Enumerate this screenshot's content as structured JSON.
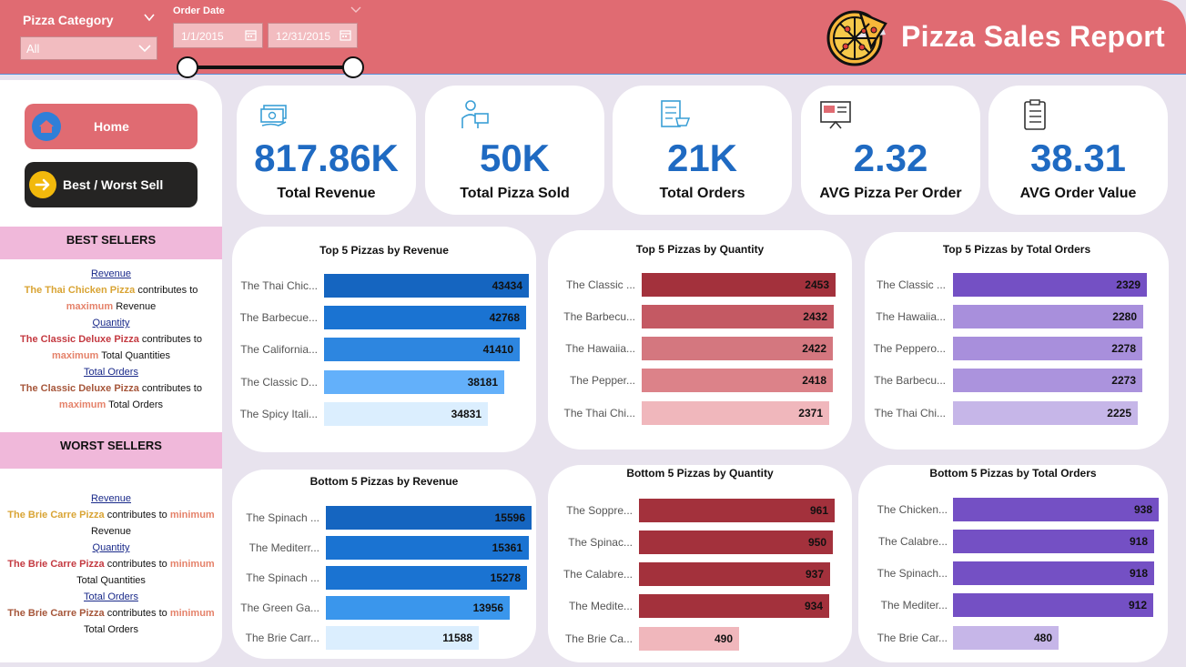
{
  "header": {
    "title": "Pizza Sales Report",
    "category_label": "Pizza Category",
    "category_value": "All",
    "date_label": "Order Date",
    "date_start": "1/1/2015",
    "date_end": "12/31/2015"
  },
  "nav": {
    "home": "Home",
    "best_worst": "Best / Worst Sell"
  },
  "best_sellers": {
    "heading": "BEST SELLERS",
    "revenue_link": "Revenue",
    "revenue_pizza": "The Thai Chicken Pizza",
    "contributes_to": "contributes to",
    "maximum": "maximum",
    "revenue_word": "Revenue",
    "quantity_link": "Quantity",
    "quantity_pizza": "The Classic Deluxe Pizza",
    "total_quantities": "Total Quantities",
    "orders_link": "Total Orders",
    "orders_pizza": "The Classic Deluxe Pizza",
    "total_orders": "Total Orders"
  },
  "worst_sellers": {
    "heading": "WORST SELLERS",
    "revenue_link": "Revenue",
    "revenue_pizza": "The Brie Carre Pizza",
    "contributes_to": "contributes to",
    "minimum": "minimum",
    "revenue_word": "Revenue",
    "quantity_link": "Quantity",
    "quantity_pizza": "The Brie Carre Pizza",
    "total_quantities": "Total Quantities",
    "orders_link": "Total Orders",
    "orders_pizza": "The Brie Carre Pizza",
    "total_orders": "Total Orders"
  },
  "kpis": [
    {
      "value": "817.86K",
      "caption": "Total Revenue",
      "icon": "money-icon"
    },
    {
      "value": "50K",
      "caption": "Total Pizza Sold",
      "icon": "delivery-icon"
    },
    {
      "value": "21K",
      "caption": "Total Orders",
      "icon": "checklist-cart-icon"
    },
    {
      "value": "2.32",
      "caption": "AVG Pizza Per Order",
      "icon": "monitor-icon"
    },
    {
      "value": "38.31",
      "caption": "AVG Order Value",
      "icon": "clipboard-icon"
    }
  ],
  "colors": {
    "header": "#e06b72",
    "kpi_value": "#1f6ac2",
    "accent_yellow": "#f2b90c"
  },
  "chart_data": [
    {
      "type": "bar",
      "title": "Top 5 Pizzas by Revenue",
      "orientation": "horizontal",
      "categories": [
        "The Thai Chic...",
        "The Barbecue...",
        "The California...",
        "The Classic D...",
        "The Spicy Itali..."
      ],
      "values": [
        43434,
        42768,
        41410,
        38181,
        34831
      ],
      "colors": [
        "#1565c0",
        "#1a73d2",
        "#2d86e0",
        "#63b0fa",
        "#dbeefe"
      ]
    },
    {
      "type": "bar",
      "title": "Top 5 Pizzas by Quantity",
      "orientation": "horizontal",
      "categories": [
        "The Classic ...",
        "The Barbecu...",
        "The Hawaiia...",
        "The Pepper...",
        "The Thai Chi..."
      ],
      "values": [
        2453,
        2432,
        2422,
        2418,
        2371
      ],
      "colors": [
        "#a3313c",
        "#c45963",
        "#d4777f",
        "#dc8289",
        "#f0b7bc"
      ]
    },
    {
      "type": "bar",
      "title": "Top 5 Pizzas by Total Orders",
      "orientation": "horizontal",
      "categories": [
        "The Classic ...",
        "The Hawaiia...",
        "The Peppero...",
        "The Barbecu...",
        "The Thai Chi..."
      ],
      "values": [
        2329,
        2280,
        2278,
        2273,
        2225
      ],
      "colors": [
        "#7450c4",
        "#a88fdc",
        "#a88fdc",
        "#ab93dd",
        "#c6b6e8"
      ]
    },
    {
      "type": "bar",
      "title": "Bottom 5 Pizzas by Revenue",
      "orientation": "horizontal",
      "categories": [
        "The Spinach ...",
        "The Mediterr...",
        "The Spinach ...",
        "The Green Ga...",
        "The Brie Carr..."
      ],
      "values": [
        15596,
        15361,
        15278,
        13956,
        11588
      ],
      "colors": [
        "#1565c0",
        "#1a73d2",
        "#1a73d2",
        "#3a96ec",
        "#dbeefe"
      ]
    },
    {
      "type": "bar",
      "title": "Bottom 5 Pizzas by Quantity",
      "orientation": "horizontal",
      "categories": [
        "The Soppre...",
        "The Spinac...",
        "The Calabre...",
        "The Medite...",
        "The Brie Ca..."
      ],
      "values": [
        961,
        950,
        937,
        934,
        490
      ],
      "colors": [
        "#a3313c",
        "#a3313c",
        "#a3313c",
        "#a3313c",
        "#f0b7bc"
      ]
    },
    {
      "type": "bar",
      "title": "Bottom 5 Pizzas by Total Orders",
      "orientation": "horizontal",
      "categories": [
        "The Chicken...",
        "The Calabre...",
        "The Spinach...",
        "The Mediter...",
        "The Brie Car..."
      ],
      "values": [
        938,
        918,
        918,
        912,
        480
      ],
      "colors": [
        "#7450c4",
        "#7450c4",
        "#7450c4",
        "#7450c4",
        "#c6b6e8"
      ]
    }
  ]
}
